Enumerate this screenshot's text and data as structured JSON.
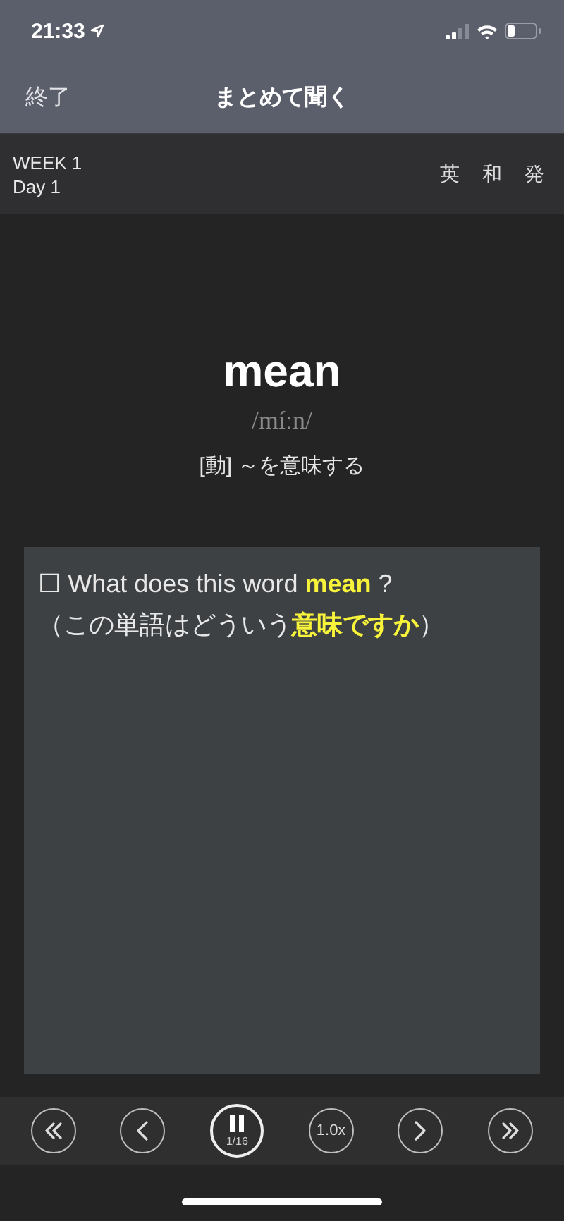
{
  "status_bar": {
    "time": "21:33"
  },
  "nav": {
    "back": "終了",
    "title": "まとめて聞く"
  },
  "header": {
    "week": "WEEK 1",
    "day": "Day 1",
    "modes": [
      {
        "label": "英"
      },
      {
        "label": "和"
      },
      {
        "label": "発"
      }
    ]
  },
  "word": {
    "headword": "mean",
    "pronunciation": "/míːn/",
    "meaning": "[動] ～を意味する"
  },
  "example": {
    "sentence": "☐ What does this word **mean** ?",
    "translation": "（この単語はどういう**意味ですか**）"
  },
  "controls": [
    {
      "kind": "rewind"
    },
    {
      "kind": "prev"
    },
    {
      "kind": "pause",
      "counter": "1/16"
    },
    {
      "kind": "speed",
      "label": "1.0x"
    },
    {
      "kind": "next"
    },
    {
      "kind": "forward"
    }
  ]
}
